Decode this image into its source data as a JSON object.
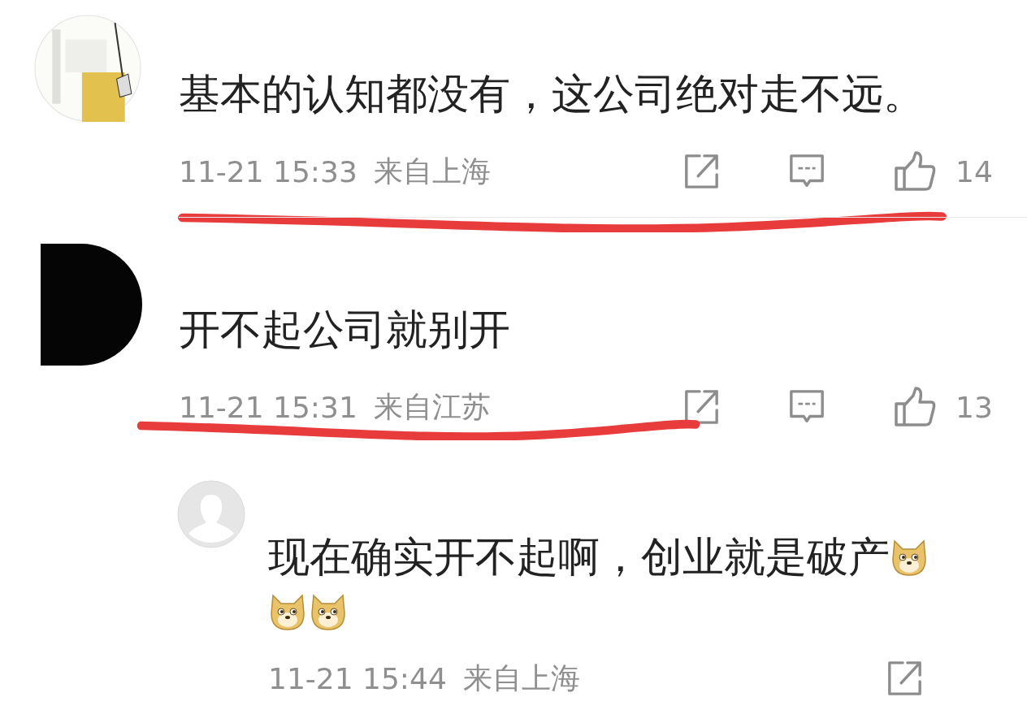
{
  "comments": [
    {
      "text": "基本的认知都没有，这公司绝对走不远。",
      "time": "11-21 15:33",
      "location": "来自上海",
      "likes": "14",
      "underlined": true
    },
    {
      "avatar": {
        "kind": "dark"
      },
      "text": "开不起公司就别开",
      "time": "11-21 15:31",
      "location": "来自江苏",
      "likes": "13",
      "underlined": true,
      "replies": [
        {
          "avatar": {
            "kind": "default"
          },
          "text": "现在确实开不起啊，创业就是破产",
          "emojis": [
            {
              "kind": "dog"
            },
            {
              "kind": "dog"
            },
            {
              "kind": "dog"
            }
          ],
          "time": "11-21 15:44",
          "location": "来自上海"
        }
      ]
    }
  ]
}
